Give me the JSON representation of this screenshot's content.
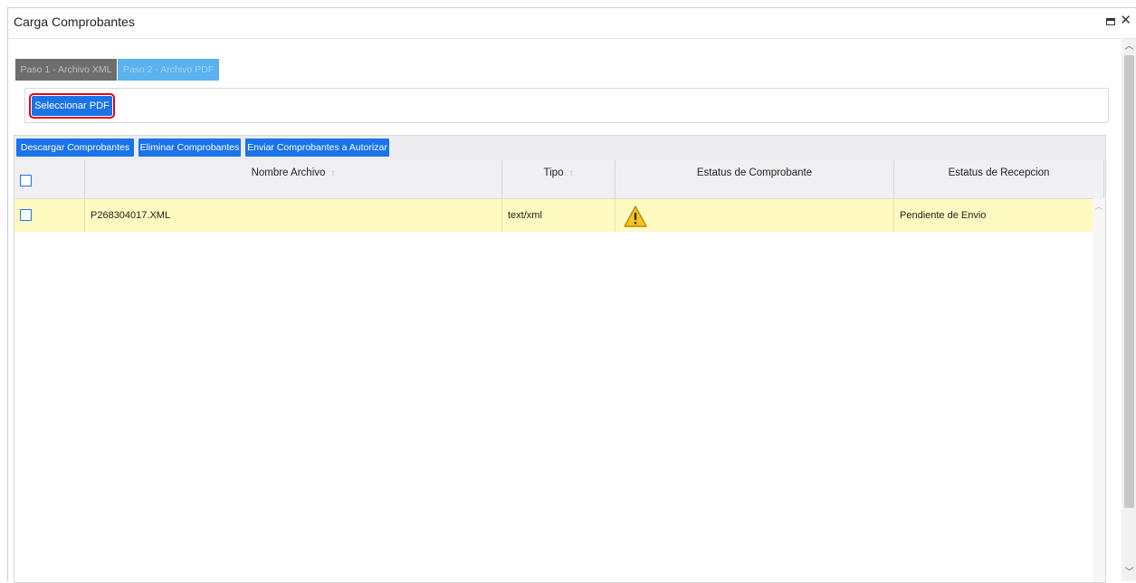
{
  "window": {
    "title": "Carga Comprobantes",
    "maximize_icon": "maximize-icon",
    "close_icon": "close-icon"
  },
  "steps": [
    {
      "label": "Paso 1 - Archivo XML"
    },
    {
      "label": "Paso 2 - Archivo PDF"
    }
  ],
  "pdf_panel": {
    "select_label": "Seleccionar PDF"
  },
  "toolbar": {
    "download_label": "Descargar Comprobantes",
    "delete_label": "Eliminar Comprobantes",
    "send_label": "Enviar Comprobantes a Autorizar"
  },
  "columns": {
    "nombre": "Nombre Archivo",
    "tipo": "Tipo",
    "estatus_comprobante": "Estatus de Comprobante",
    "estatus_recepcion": "Estatus de Recepcion"
  },
  "rows": [
    {
      "nombre": "P268304017.XML",
      "tipo": "text/xml",
      "estatus_comprobante_icon": "warning-icon",
      "estatus_recepcion": "Pendiente de Envio"
    }
  ],
  "colors": {
    "accent": "#1a73e8",
    "highlight_row": "#fffac0",
    "step1": "#6e6e6e",
    "step2": "#5ab2ee",
    "selection_outline": "#e0000f"
  }
}
